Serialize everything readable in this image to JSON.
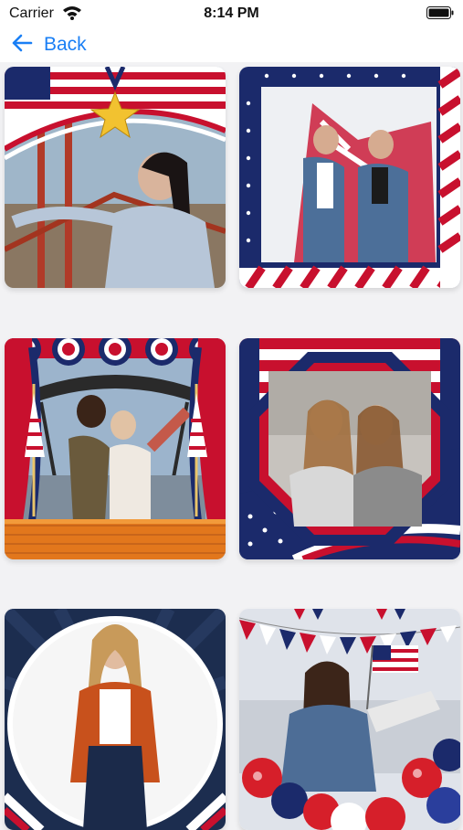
{
  "status_bar": {
    "carrier": "Carrier",
    "time": "8:14 PM",
    "wifi_icon": "wifi-icon",
    "battery_icon": "battery-icon"
  },
  "nav": {
    "back_label": "Back",
    "back_icon": "arrow-left-icon"
  },
  "colors": {
    "accent": "#1a7ff5",
    "flag_red": "#c8102e",
    "flag_blue": "#1b2a6b",
    "background": "#f2f2f4"
  },
  "frames": [
    {
      "id": "frame-1",
      "theme": "flag-arch-with-gold-star-medal"
    },
    {
      "id": "frame-2",
      "theme": "stars-and-stripes-border"
    },
    {
      "id": "frame-3",
      "theme": "stage-curtains-with-flags"
    },
    {
      "id": "frame-4",
      "theme": "octagon-frame-with-flag"
    },
    {
      "id": "frame-5",
      "theme": "circle-frame-navy"
    },
    {
      "id": "frame-6",
      "theme": "bunting-and-balloons"
    }
  ]
}
